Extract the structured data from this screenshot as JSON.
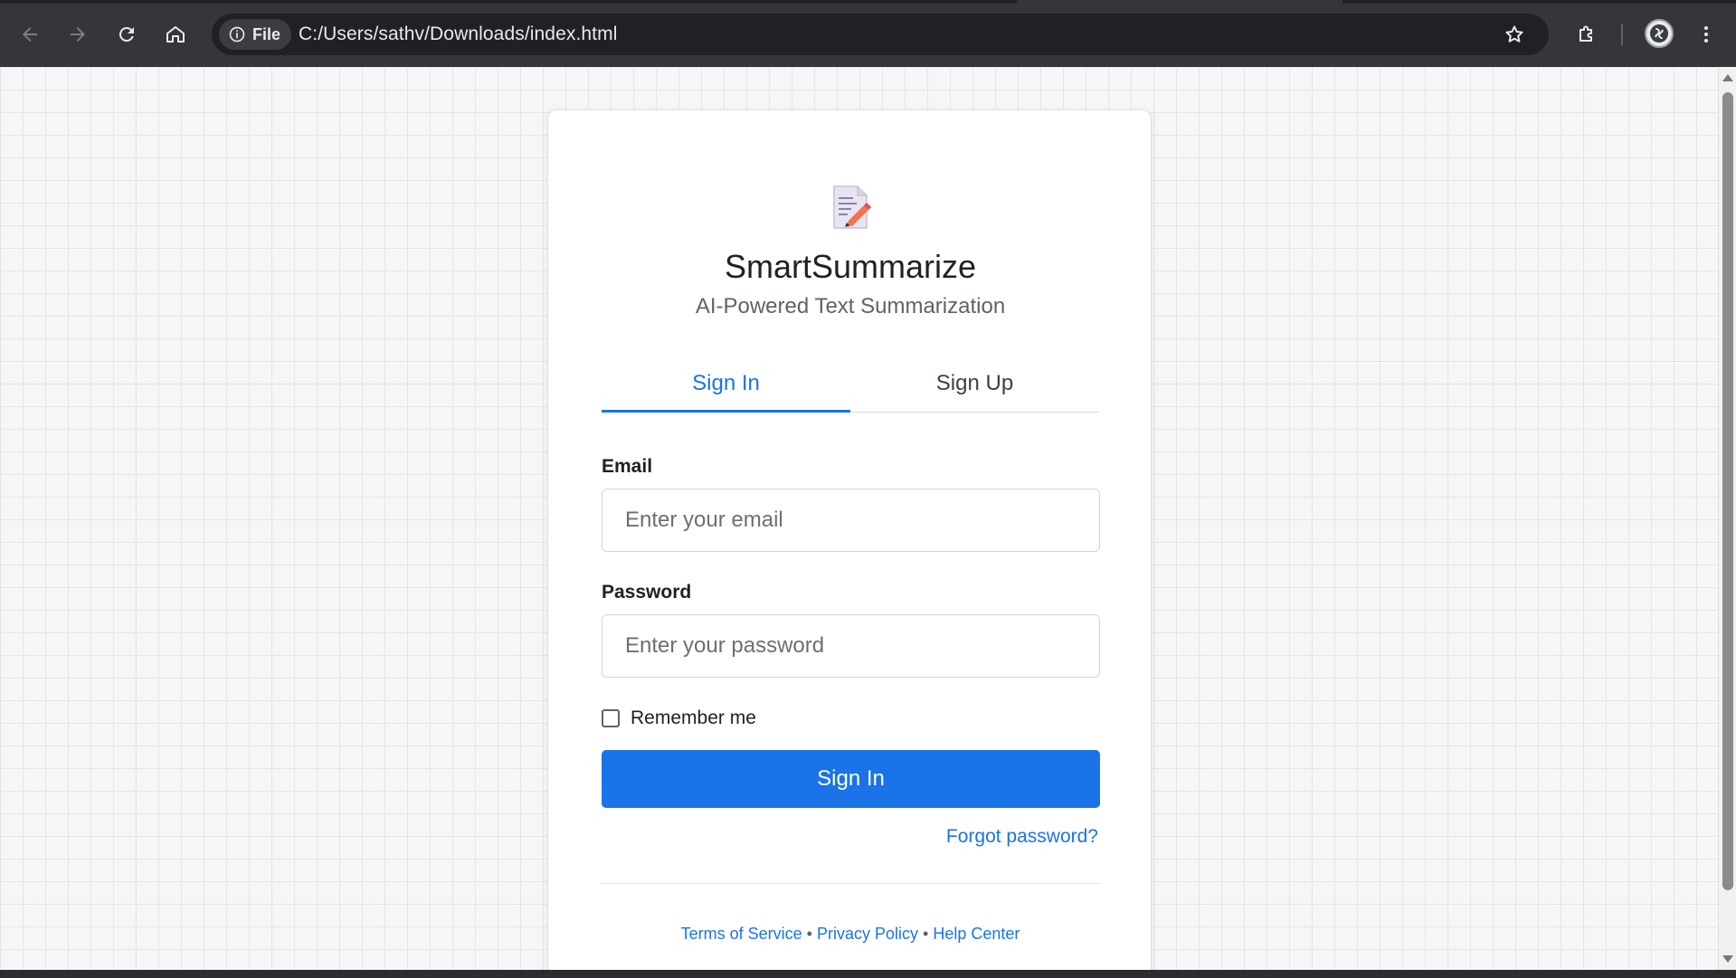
{
  "browser": {
    "site_chip_label": "File",
    "url": "C:/Users/sathv/Downloads/index.html",
    "icons": {
      "back": "arrow-left-icon",
      "forward": "arrow-right-icon",
      "reload": "reload-icon",
      "home": "home-icon",
      "info": "info-icon",
      "star": "star-icon",
      "extensions": "puzzle-icon",
      "profile": "avatar",
      "menu": "kebab-menu-icon"
    }
  },
  "app": {
    "logo_icon": "memo-pencil-icon",
    "title": "SmartSummarize",
    "subtitle": "AI-Powered Text Summarization"
  },
  "tabs": [
    {
      "label": "Sign In",
      "active": true
    },
    {
      "label": "Sign Up",
      "active": false
    }
  ],
  "form": {
    "email_label": "Email",
    "email_placeholder": "Enter your email",
    "email_value": "",
    "password_label": "Password",
    "password_placeholder": "Enter your password",
    "password_value": "",
    "remember_label": "Remember me",
    "remember_checked": false,
    "submit_label": "Sign In",
    "forgot_label": "Forgot password?"
  },
  "footer": {
    "links": [
      "Terms of Service",
      "Privacy Policy",
      "Help Center"
    ],
    "separator": "•"
  },
  "colors": {
    "accent": "#1a73e8",
    "chrome_bg": "#35363a",
    "page_bg": "#f5f6f8",
    "grid_line": "#e3e5e9"
  }
}
